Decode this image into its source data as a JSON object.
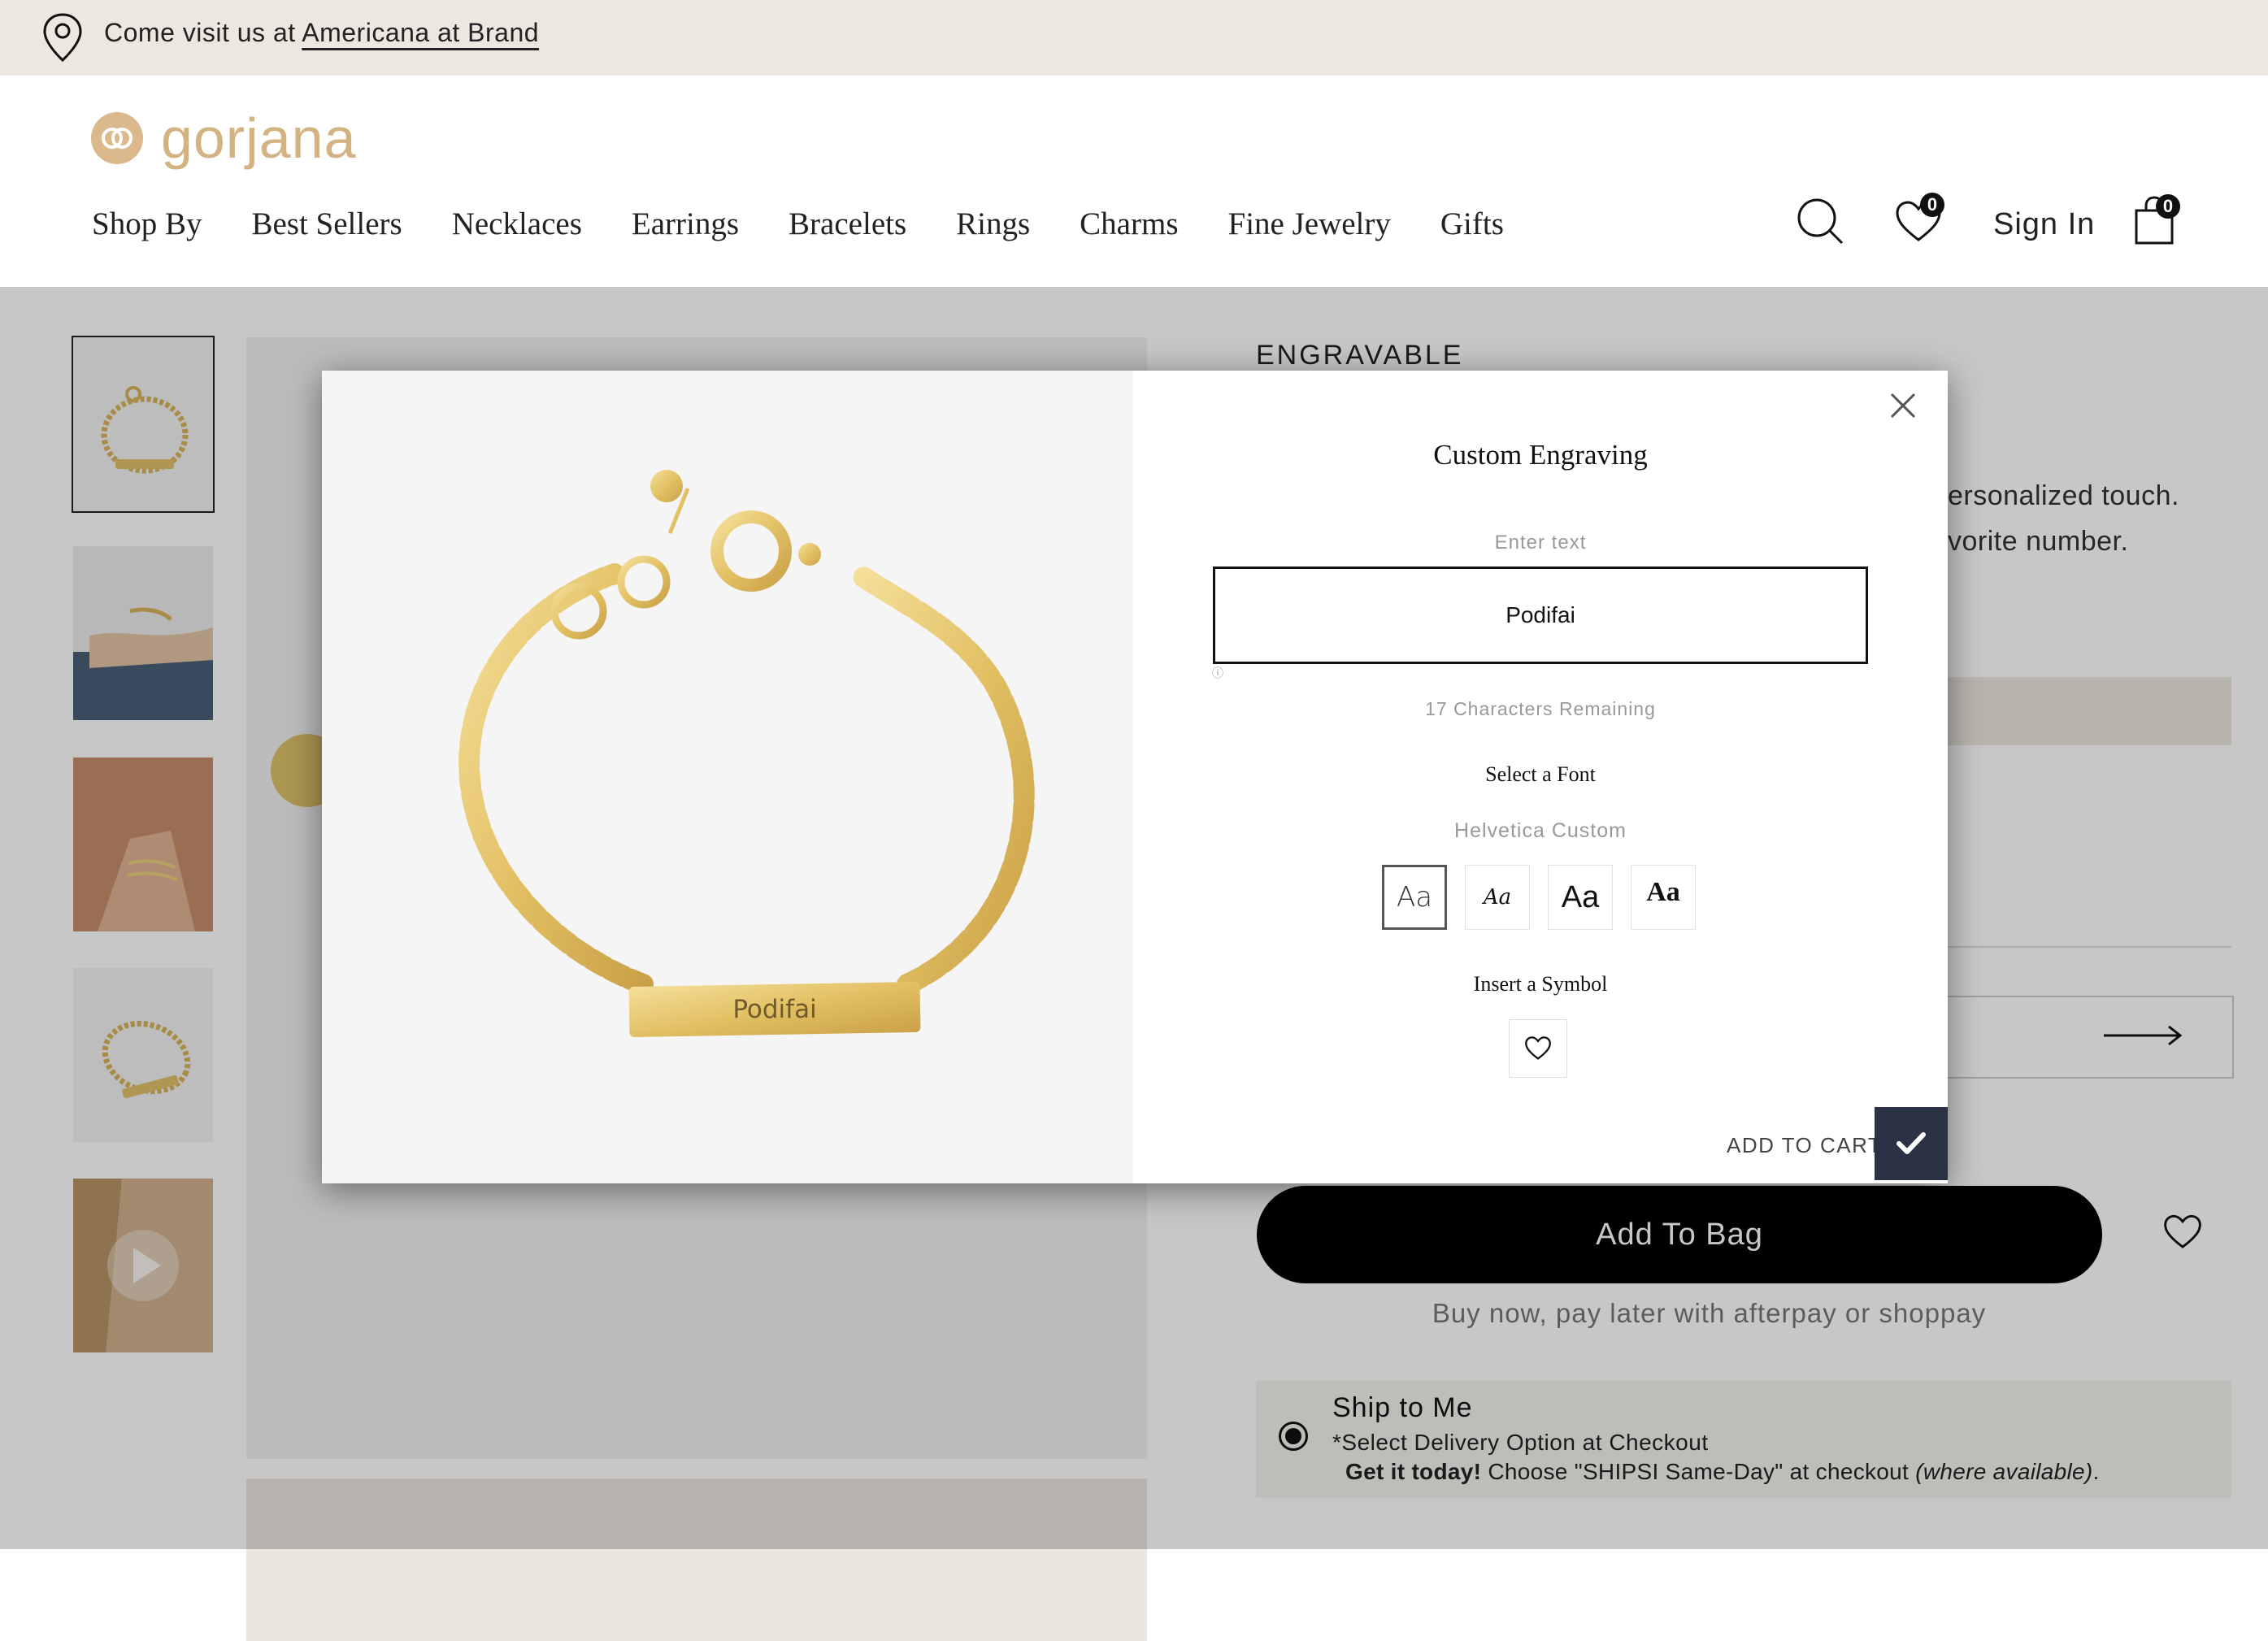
{
  "promo": {
    "prefix": "Come visit us at ",
    "link": "Americana at Brand"
  },
  "header": {
    "logo_text": "gorjana",
    "nav": [
      "Shop By",
      "Best Sellers",
      "Necklaces",
      "Earrings",
      "Bracelets",
      "Rings",
      "Charms",
      "Fine Jewelry",
      "Gifts"
    ],
    "wishlist_count": "0",
    "sign_in": "Sign In",
    "cart_count": "0"
  },
  "product": {
    "engravable_label": "ENGRAVABLE",
    "desc_line1": "ersonalized touch.",
    "desc_line2": "vorite number.",
    "add_to_bag": "Add To Bag",
    "pay_later": "Buy now, pay later with afterpay or shoppay",
    "shipping": {
      "title": "Ship to Me",
      "line1": "*Select Delivery Option at Checkout",
      "line2_bold": "Get it today!",
      "line2_text": " Choose \"SHIPSI Same-Day\" at checkout ",
      "line2_italic": "(where available)",
      "line2_end": "."
    }
  },
  "modal": {
    "title": "Custom Engraving",
    "enter_label": "Enter text",
    "input_value": "Podifai",
    "remaining": "17 Characters Remaining",
    "font_label": "Select a Font",
    "font_selected": "Helvetica Custom",
    "font_options": [
      "Aa",
      "Aa",
      "Aa",
      "Aa"
    ],
    "symbol_label": "Insert a Symbol",
    "add_to_cart": "ADD TO CART",
    "preview_engraving": "Podifai"
  },
  "colors": {
    "promo_bg": "#ece8df",
    "logo_gold": "#d3b382",
    "confirm_navy": "#2b3245"
  }
}
